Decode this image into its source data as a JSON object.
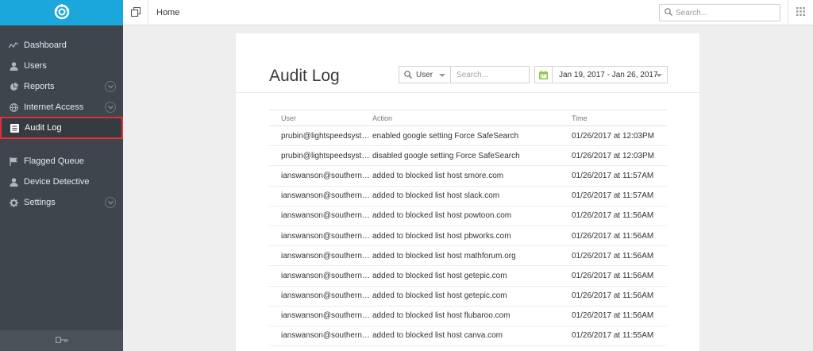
{
  "colors": {
    "brand": "#1ba7dc",
    "sidebar": "#3e454c",
    "active_outline": "#e0303a",
    "calendar_icon": "#8cc63f"
  },
  "sidebar": {
    "logo": "lightspeed-logo-icon",
    "items": [
      {
        "label": "Dashboard",
        "icon": "activity-icon"
      },
      {
        "label": "Users",
        "icon": "user-icon"
      },
      {
        "label": "Reports",
        "icon": "pie-chart-icon",
        "expandable": true
      },
      {
        "label": "Internet Access",
        "icon": "globe-icon",
        "expandable": true
      },
      {
        "label": "Audit Log",
        "icon": "list-icon",
        "active": true
      },
      {
        "label": "Flagged Queue",
        "icon": "flag-icon"
      },
      {
        "label": "Device Detective",
        "icon": "user-icon"
      },
      {
        "label": "Settings",
        "icon": "gear-icon",
        "expandable": true
      }
    ],
    "footer_icon": "key-icon"
  },
  "topbar": {
    "breadcrumb": "Home",
    "search_placeholder": "Search...",
    "apps_icon": "grid-icon"
  },
  "main": {
    "title": "Audit Log",
    "filter": {
      "selected": "User",
      "placeholder": "Search..."
    },
    "date_range": "Jan 19, 2017 - Jan 26, 2017",
    "columns": [
      "User",
      "Action",
      "Time"
    ],
    "rows": [
      {
        "user": "prubin@lightspeedsyst…",
        "action": "enabled google setting Force SafeSearch",
        "time": "01/26/2017 at 12:03PM"
      },
      {
        "user": "prubin@lightspeedsyst…",
        "action": "disabled google setting Force SafeSearch",
        "time": "01/26/2017 at 12:03PM"
      },
      {
        "user": "ianswanson@southern…",
        "action": "added to blocked list host smore.com",
        "time": "01/26/2017 at 11:57AM"
      },
      {
        "user": "ianswanson@southern…",
        "action": "added to blocked list host slack.com",
        "time": "01/26/2017 at 11:57AM"
      },
      {
        "user": "ianswanson@southern…",
        "action": "added to blocked list host powtoon.com",
        "time": "01/26/2017 at 11:56AM"
      },
      {
        "user": "ianswanson@southern…",
        "action": "added to blocked list host pbworks.com",
        "time": "01/26/2017 at 11:56AM"
      },
      {
        "user": "ianswanson@southern…",
        "action": "added to blocked list host mathforum.org",
        "time": "01/26/2017 at 11:56AM"
      },
      {
        "user": "ianswanson@southern…",
        "action": "added to blocked list host getepic.com",
        "time": "01/26/2017 at 11:56AM"
      },
      {
        "user": "ianswanson@southern…",
        "action": "added to blocked list host getepic.com",
        "time": "01/26/2017 at 11:56AM"
      },
      {
        "user": "ianswanson@southern…",
        "action": "added to blocked list host flubaroo.com",
        "time": "01/26/2017 at 11:56AM"
      },
      {
        "user": "ianswanson@southern…",
        "action": "added to blocked list host canva.com",
        "time": "01/26/2017 at 11:55AM"
      }
    ]
  }
}
